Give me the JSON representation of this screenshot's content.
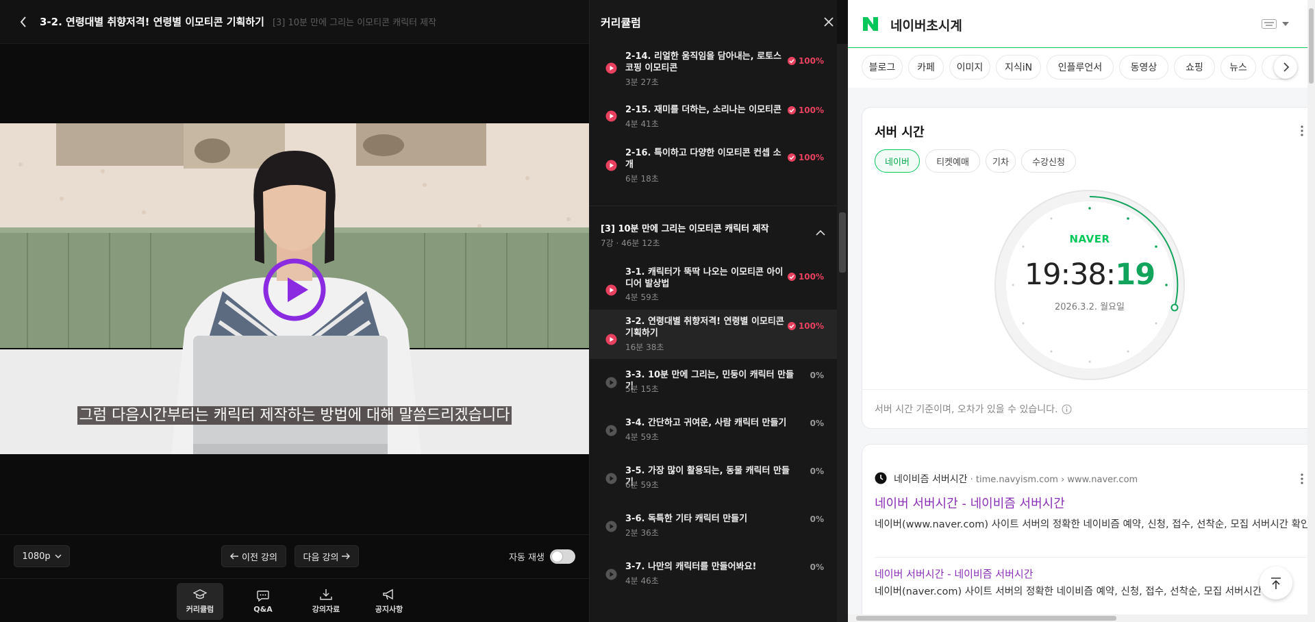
{
  "player": {
    "lecture_title": "3-2. 연령대별 취향저격! 연령별 이모티콘 기획하기",
    "section_title": "[3] 10분 만에 그리는 이모티콘 캐릭터 제작",
    "subtitle": "그럼 다음시간부터는 캐릭터 제작하는 방법에 대해 말씀드리겠습니다",
    "quality": "1080p",
    "prev_label": "이전 강의",
    "next_label": "다음 강의",
    "autoplay_label": "자동 재생",
    "autoplay_on": false,
    "bottom_tabs": [
      {
        "label": "커리큘럼",
        "icon": "graduation-cap-icon",
        "active": true
      },
      {
        "label": "Q&A",
        "icon": "chat-bubble-icon",
        "active": false
      },
      {
        "label": "강의자료",
        "icon": "download-icon",
        "active": false
      },
      {
        "label": "공지사항",
        "icon": "megaphone-icon",
        "active": false
      }
    ]
  },
  "curriculum": {
    "title": "커리큘럼",
    "prev_lessons": [
      {
        "title": "2-14. 리얼한 움직임을 담아내는, 로토스코핑 이모티콘",
        "duration": "3분 27초",
        "progress": "100%",
        "done": true
      },
      {
        "title": "2-15. 재미를 더하는, 소리나는 이모티콘",
        "duration": "4분 41초",
        "progress": "100%",
        "done": true
      },
      {
        "title": "2-16. 특이하고 다양한 이모티콘 컨셉 소개",
        "duration": "6분 18초",
        "progress": "100%",
        "done": true
      }
    ],
    "section": {
      "title": "[3] 10분 만에 그리는 이모티콘 캐릭터 제작",
      "meta": "7강 · 46분 12초"
    },
    "lessons": [
      {
        "title": "3-1. 캐릭터가 뚝딱 나오는 이모티콘 아이디어 발상법",
        "duration": "4분 59초",
        "progress": "100%",
        "done": true
      },
      {
        "title": "3-2. 연령대별 취향저격! 연령별 이모티콘 기획하기",
        "duration": "16분 38초",
        "progress": "100%",
        "done": true,
        "active": true
      },
      {
        "title": "3-3. 10분 만에 그리는, 민둥이 캐릭터 만들기",
        "duration": "5분 15초",
        "progress": "0%",
        "done": false
      },
      {
        "title": "3-4. 간단하고 귀여운, 사람 캐릭터 만들기",
        "duration": "4분 59초",
        "progress": "0%",
        "done": false
      },
      {
        "title": "3-5. 가장 많이 활용되는, 동물 캐릭터 만들기",
        "duration": "6분 59초",
        "progress": "0%",
        "done": false
      },
      {
        "title": "3-6. 독특한 기타 캐릭터 만들기",
        "duration": "2분 36초",
        "progress": "0%",
        "done": false
      },
      {
        "title": "3-7. 나만의 캐릭터를 만들어봐요!",
        "duration": "4분 46초",
        "progress": "0%",
        "done": false
      }
    ]
  },
  "naver": {
    "logo_letter": "N",
    "query": "네이버초시계",
    "tabs": [
      "블로그",
      "카페",
      "이미지",
      "지식iN",
      "인플루언서",
      "동영상",
      "쇼핑",
      "뉴스",
      "쇼"
    ],
    "card": {
      "title": "서버 시간",
      "chips": [
        "네이버",
        "티켓예매",
        "기차",
        "수강신청"
      ],
      "selected_chip": "네이버",
      "clock_brand": "NAVER",
      "time_hm": "19:38:",
      "time_s": "19",
      "date": "2026.3.2.  월요일",
      "note": "서버 시간 기준이며, 오차가 있을 수 있습니다."
    },
    "result": {
      "site_name": "네이비즘 서버시간",
      "site_crumb": " · time.navyism.com › www.naver.com",
      "title": "네이버 서버시간 - 네이비즘 서버시간",
      "desc": "네이버(www.naver.com) 사이트 서버의 정확한 네이비즘 예약, 신청, 접수, 선착순, 모집 서버시간 확인",
      "sub_title": "네이버 서버시간 - 네이비즘 서버시간",
      "sub_desc": "네이버(naver.com) 사이트 서버의 정확한 네이비즘 예약, 신청, 접수, 선착순, 모집 서버시간 확인"
    }
  },
  "colors": {
    "accent_red": "#e8415f",
    "naver_green": "#03c75a",
    "visited_purple": "#8a2fb5",
    "play_purple": "#8a2be2"
  }
}
